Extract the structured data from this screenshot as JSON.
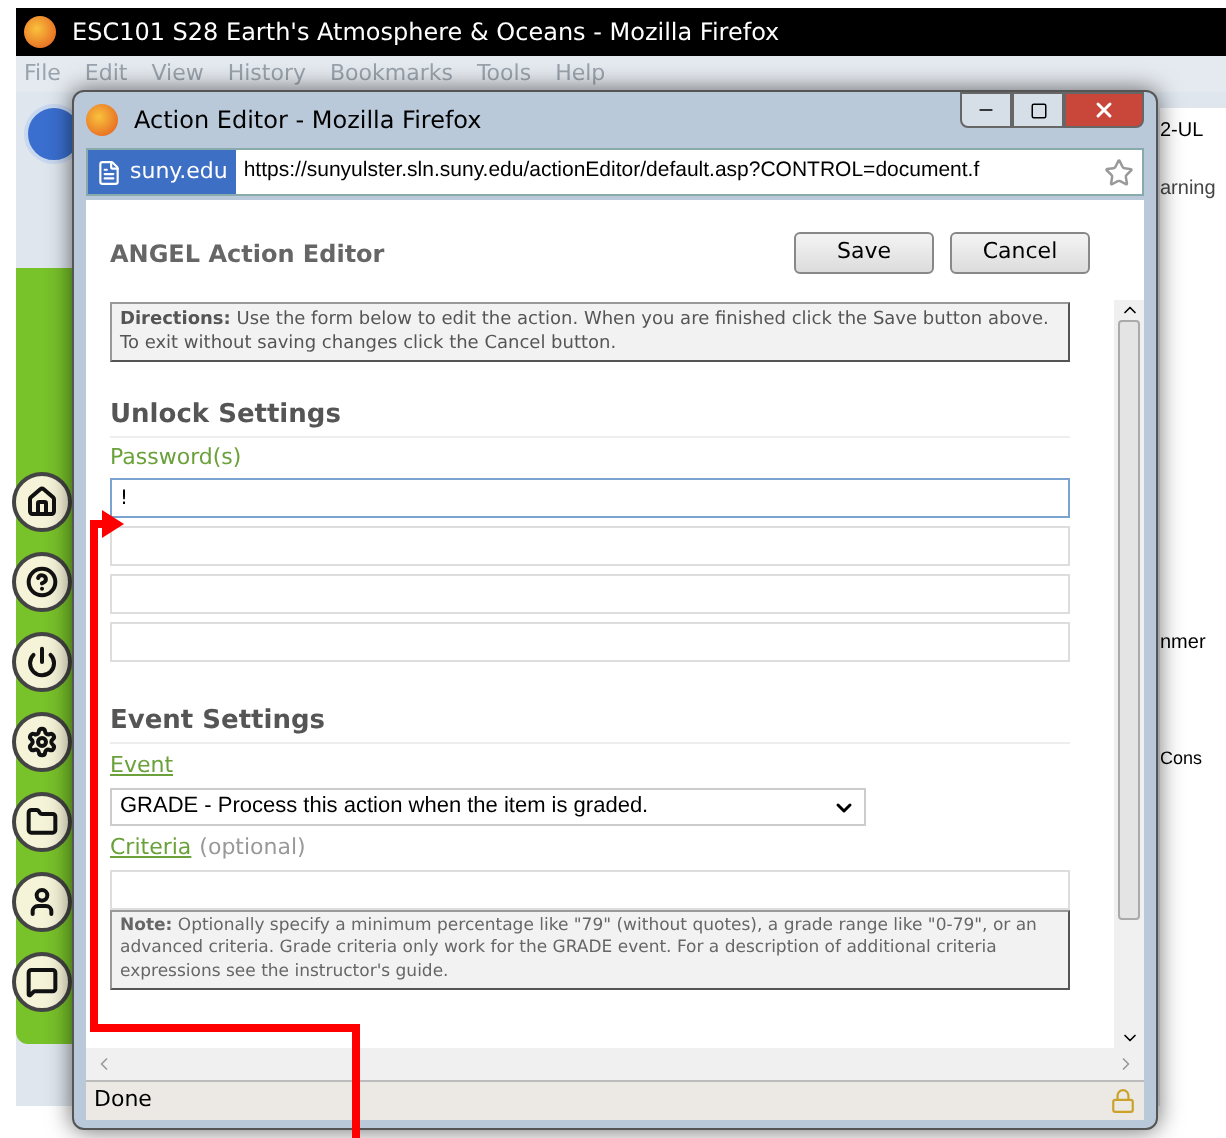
{
  "background_window": {
    "title": "ESC101 S28 Earth's Atmosphere & Oceans - Mozilla Firefox",
    "menu": [
      "File",
      "Edit",
      "View",
      "History",
      "Bookmarks",
      "Tools",
      "Help"
    ],
    "fragments": [
      "2-UL",
      "arning",
      "nmer",
      "Cons"
    ]
  },
  "popup": {
    "title": "Action Editor - Mozilla Firefox",
    "site_badge": "suny.edu",
    "url": "https://sunyulster.sln.suny.edu/actionEditor/default.asp?CONTROL=document.f",
    "status": "Done"
  },
  "editor": {
    "heading": "ANGEL Action Editor",
    "buttons": [
      "Save",
      "Cancel"
    ],
    "directions": "**Directions:** Use the form below to edit the action. When you are finished click the Save button above. To exit without saving changes click the Cancel button.",
    "unlock_settings": {
      "title": "Unlock Settings",
      "label": "Password(s)",
      "fields": [
        {
          "value": "!",
          "focused": true
        },
        {
          "focused": false
        },
        {
          "focused": false
        },
        {
          "focused": false
        }
      ]
    },
    "event_settings": {
      "title": "Event Settings",
      "event_label": "Event",
      "event_value": "GRADE - Process this action when the item is graded.",
      "criteria_label": "Criteria",
      "criteria_hint": "(optional)"
    },
    "note": "**Note:** Optionally specify a minimum percentage like \"79\" (without quotes), a grade range like \"0-79\", or an advanced criteria. Grade criteria only work for the GRADE event. For a description of additional criteria expressions see the instructor's guide."
  }
}
